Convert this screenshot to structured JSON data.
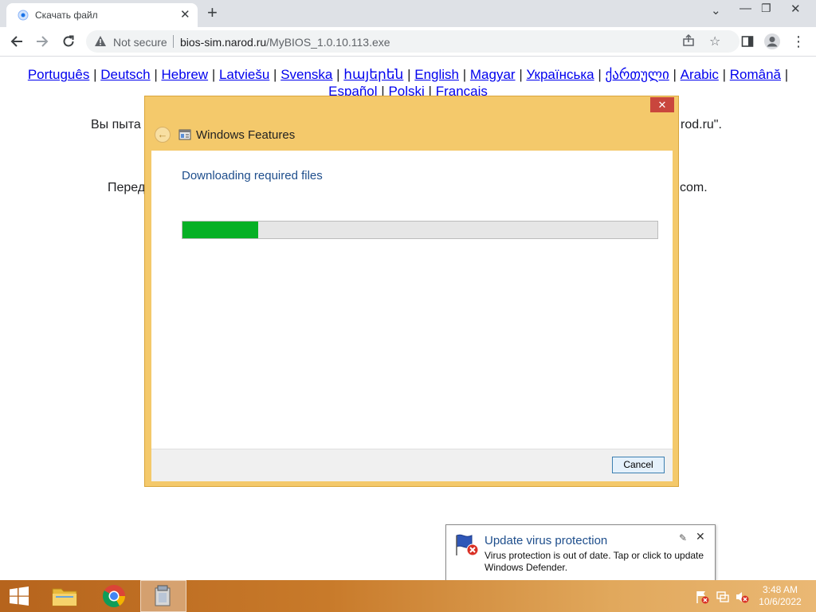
{
  "browser": {
    "tab": {
      "title": "Скачать файл"
    },
    "address": {
      "security_label": "Not secure",
      "url_host": "bios-sim.narod.ru",
      "url_path": "/MyBIOS_1.0.10.113.exe"
    }
  },
  "page": {
    "languages": [
      "Português",
      "Deutsch",
      "Hebrew",
      "Latviešu",
      "Svenska",
      "հայերեն",
      "English",
      "Magyar",
      "Українська",
      "ქართული",
      "Arabic",
      "Română",
      "Español",
      "Polski",
      "Français"
    ],
    "separator": "|",
    "text_line1_left": "Вы пыта",
    "text_line1_right": "rod.ru\".",
    "text_line2_left": "Перед",
    "text_line2_right": "com."
  },
  "dialog": {
    "title": "Windows Features",
    "heading": "Downloading required files",
    "progress_fraction": 0.16,
    "cancel_label": "Cancel",
    "close_glyph": "✕",
    "accent_color": "#f4c96b",
    "progress_color": "#06b025"
  },
  "toast": {
    "title": "Update virus protection",
    "message": "Virus protection is out of date. Tap or click to update Windows Defender."
  },
  "taskbar": {
    "time": "3:48 AM",
    "date": "10/6/2022"
  }
}
